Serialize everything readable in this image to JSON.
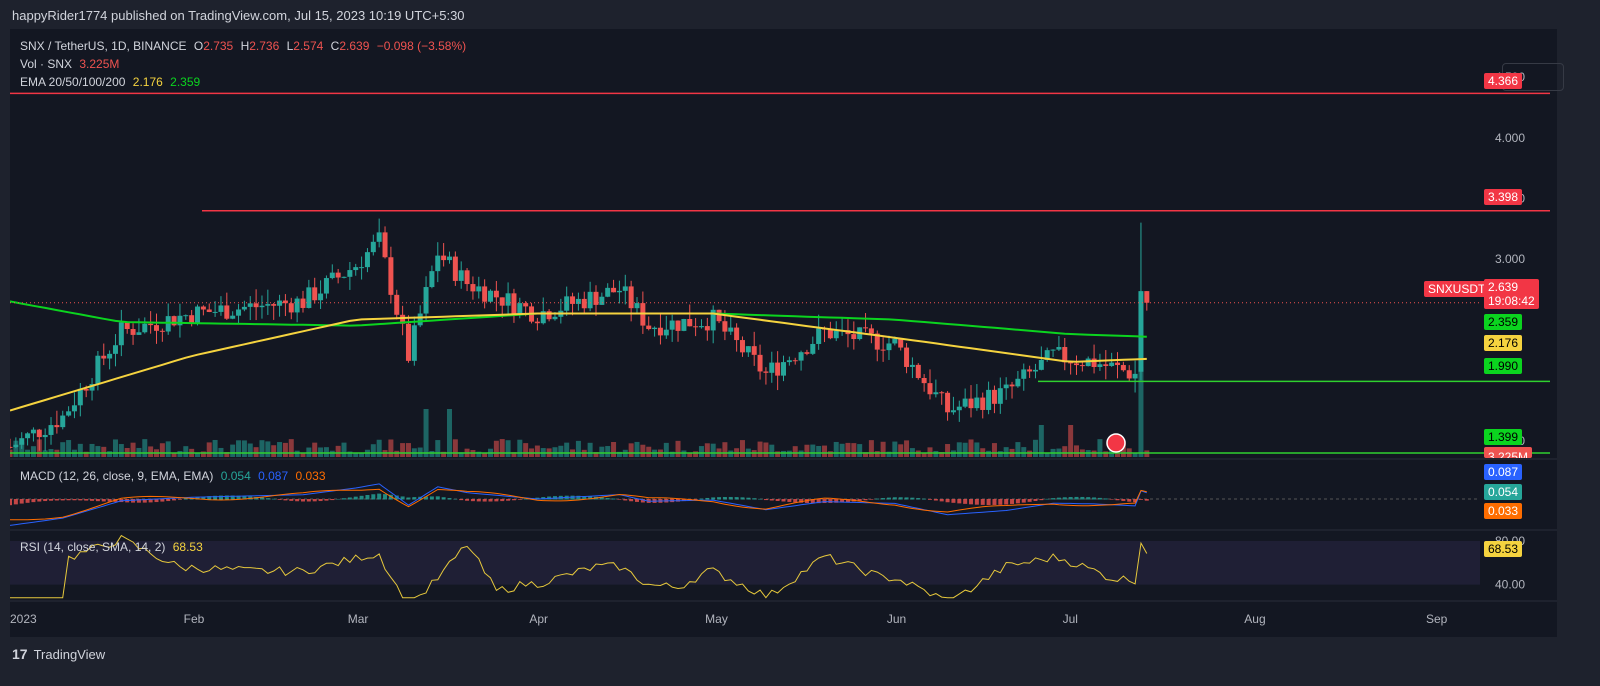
{
  "publisher": "happyRider1774 published on TradingView.com, Jul 15, 2023 10:19 UTC+5:30",
  "footer": {
    "brand": "TradingView"
  },
  "legend": {
    "symbol": "SNX / TetherUS, 1D, BINANCE",
    "o_label": "O",
    "o": "2.735",
    "h_label": "H",
    "h": "2.736",
    "l_label": "L",
    "l": "2.574",
    "c_label": "C",
    "c": "2.639",
    "change": "−0.098 (−3.58%)",
    "vol_label": "Vol · SNX",
    "vol": "3.225M",
    "ema_label": "EMA 20/50/100/200",
    "ema1": "2.176",
    "ema2": "2.359",
    "macd_label": "MACD (12, 26, close, 9, EMA, EMA)",
    "macd1": "0.054",
    "macd2": "0.087",
    "macd3": "0.033",
    "rsi_label": "RSI (14, close, SMA, 14, 2)",
    "rsi": "68.53"
  },
  "price_axis": [
    "4.500",
    "4.000",
    "3.500",
    "3.000",
    "1.500"
  ],
  "rsi_axis": [
    "80.00",
    "40.00"
  ],
  "x_axis": [
    "2023",
    "Feb",
    "Mar",
    "Apr",
    "May",
    "Jun",
    "Jul",
    "Aug",
    "Sep"
  ],
  "price_labels": {
    "r1": "4.366",
    "r2": "3.398",
    "ticker": "SNXUSDT",
    "price": "2.639",
    "countdown": "19:08:42",
    "ema_green": "2.359",
    "ema_yellow": "2.176",
    "s1": "1.990",
    "s2": "1.399",
    "vol": "3.225M"
  },
  "macd_labels": {
    "signal": "0.087",
    "macd": "0.054",
    "hist": "0.033"
  },
  "rsi_label_value": "68.53",
  "colors": {
    "up": "#26a69a",
    "down": "#ef5350",
    "ema20": "#f5d33f",
    "ema50": "#0bd41f",
    "resistance": "#f23645",
    "support": "#2fd12f",
    "macd": "#2962ff",
    "signal": "#ff6d00",
    "rsi": "#e6c83c"
  },
  "chart_data": {
    "type": "candlestick",
    "symbol": "SNX / TetherUS",
    "interval": "1D",
    "ohlc_last": {
      "open": 2.735,
      "high": 2.736,
      "low": 2.574,
      "close": 2.639
    },
    "price_points": [
      {
        "date": "2023-01-01",
        "close": 1.45
      },
      {
        "date": "2023-01-10",
        "close": 1.7
      },
      {
        "date": "2023-01-20",
        "close": 2.4
      },
      {
        "date": "2023-02-01",
        "close": 2.55
      },
      {
        "date": "2023-02-10",
        "close": 2.6
      },
      {
        "date": "2023-02-20",
        "close": 2.65
      },
      {
        "date": "2023-03-01",
        "close": 2.95
      },
      {
        "date": "2023-03-05",
        "close": 3.15
      },
      {
        "date": "2023-03-10",
        "close": 2.2
      },
      {
        "date": "2023-03-15",
        "close": 3.05
      },
      {
        "date": "2023-03-20",
        "close": 2.8
      },
      {
        "date": "2023-04-01",
        "close": 2.55
      },
      {
        "date": "2023-04-15",
        "close": 2.75
      },
      {
        "date": "2023-04-20",
        "close": 2.45
      },
      {
        "date": "2023-05-01",
        "close": 2.5
      },
      {
        "date": "2023-05-10",
        "close": 2.05
      },
      {
        "date": "2023-05-20",
        "close": 2.4
      },
      {
        "date": "2023-06-01",
        "close": 2.3
      },
      {
        "date": "2023-06-10",
        "close": 1.75
      },
      {
        "date": "2023-06-20",
        "close": 1.9
      },
      {
        "date": "2023-06-28",
        "close": 2.2
      },
      {
        "date": "2023-07-05",
        "close": 2.15
      },
      {
        "date": "2023-07-12",
        "close": 2.05
      },
      {
        "date": "2023-07-13",
        "close": 2.735
      },
      {
        "date": "2023-07-14",
        "close": 2.639
      }
    ],
    "ema20": [
      {
        "date": "2023-01-01",
        "value": 1.75
      },
      {
        "date": "2023-02-01",
        "value": 2.2
      },
      {
        "date": "2023-03-01",
        "value": 2.5
      },
      {
        "date": "2023-04-01",
        "value": 2.55
      },
      {
        "date": "2023-05-01",
        "value": 2.55
      },
      {
        "date": "2023-06-01",
        "value": 2.35
      },
      {
        "date": "2023-07-01",
        "value": 2.15
      },
      {
        "date": "2023-07-14",
        "value": 2.176
      }
    ],
    "ema50": [
      {
        "date": "2023-01-01",
        "value": 2.65
      },
      {
        "date": "2023-01-20",
        "value": 2.48
      },
      {
        "date": "2023-03-01",
        "value": 2.45
      },
      {
        "date": "2023-04-01",
        "value": 2.55
      },
      {
        "date": "2023-05-01",
        "value": 2.55
      },
      {
        "date": "2023-06-01",
        "value": 2.5
      },
      {
        "date": "2023-07-01",
        "value": 2.38
      },
      {
        "date": "2023-07-14",
        "value": 2.359
      }
    ],
    "horizontal_levels": [
      {
        "price": 4.366,
        "color": "#f23645"
      },
      {
        "price": 3.398,
        "color": "#f23645"
      },
      {
        "price": 1.99,
        "color": "#2fd12f"
      },
      {
        "price": 1.399,
        "color": "#2fd12f"
      }
    ],
    "y_range": [
      1.35,
      4.65
    ],
    "volume_last": "3.225M",
    "macd": {
      "macd": 0.054,
      "signal": 0.087,
      "histogram": 0.033
    },
    "rsi": {
      "value": 68.53,
      "levels": [
        40,
        80
      ]
    }
  }
}
